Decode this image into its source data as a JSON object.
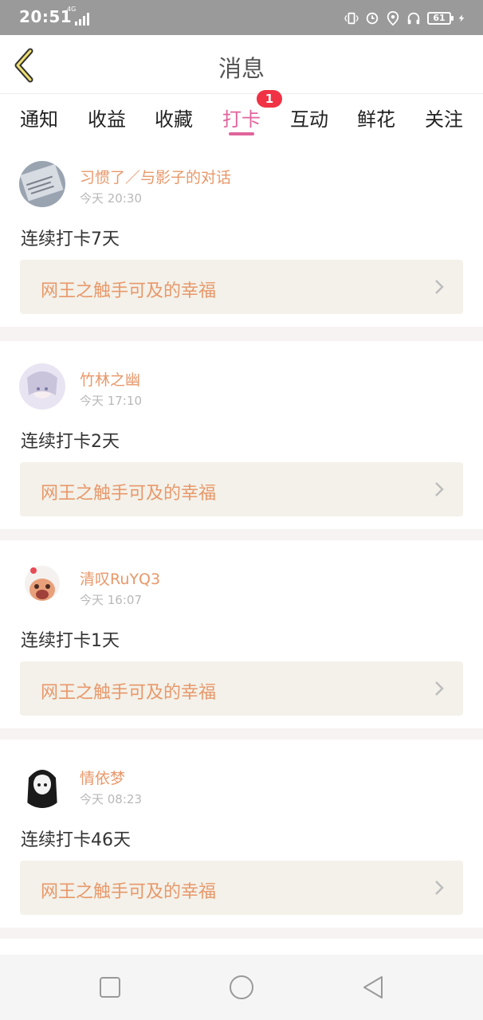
{
  "status_bar": {
    "time": "20:51",
    "network": "4G",
    "battery": "61"
  },
  "header": {
    "title": "消息"
  },
  "tabs": [
    {
      "label": "通知"
    },
    {
      "label": "收益"
    },
    {
      "label": "收藏"
    },
    {
      "label": "打卡",
      "active": true,
      "badge": "1"
    },
    {
      "label": "互动"
    },
    {
      "label": "鲜花"
    },
    {
      "label": "关注"
    }
  ],
  "messages": [
    {
      "username": "习惯了／与影子的对话",
      "time": "今天 20:30",
      "text": "连续打卡7天",
      "book": "网王之触手可及的幸福"
    },
    {
      "username": "竹林之幽",
      "time": "今天 17:10",
      "text": "连续打卡2天",
      "book": "网王之触手可及的幸福"
    },
    {
      "username": "清叹RuYQ3",
      "time": "今天 16:07",
      "text": "连续打卡1天",
      "book": "网王之触手可及的幸福"
    },
    {
      "username": "情依梦",
      "time": "今天 08:23",
      "text": "连续打卡46天",
      "book": "网王之触手可及的幸福"
    }
  ],
  "colors": {
    "accent": "#e0659c",
    "name": "#e8986a",
    "badge": "#f03244"
  }
}
